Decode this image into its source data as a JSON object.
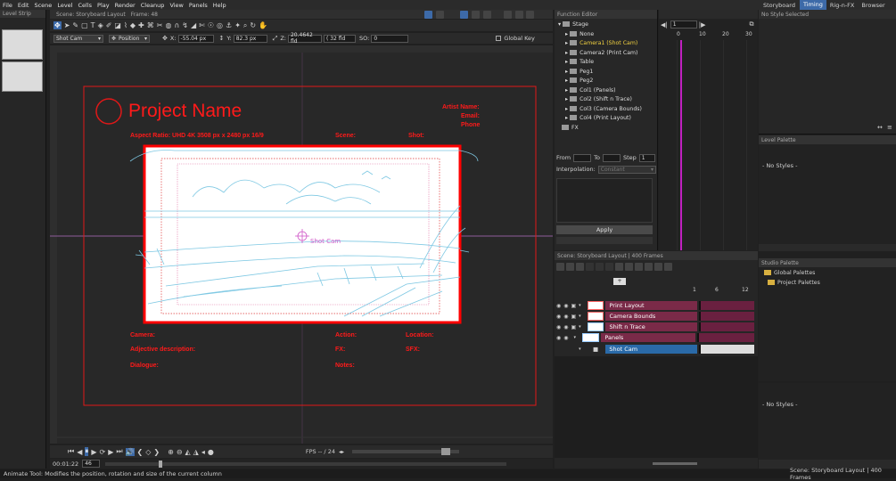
{
  "menu": [
    "File",
    "Edit",
    "Scene",
    "Level",
    "Cells",
    "Play",
    "Render",
    "Cleanup",
    "View",
    "Panels",
    "Help"
  ],
  "level_strip": {
    "title": "Level Strip"
  },
  "viewer": {
    "title": "Scene: Storyboard Layout",
    "frame": "Frame: 48"
  },
  "tool_options": {
    "object": "Shot Cam",
    "mode": "Position",
    "x_label": "X:",
    "x_value": "-55.04 px",
    "y_label": "Y:",
    "y_value": "82.3 px",
    "z_label": "Z:",
    "z_value": "20.4642 fld",
    "z_fld": "( 32 fld",
    "so_label": "SO:",
    "so_value": "0",
    "global_key": "Global Key"
  },
  "storyboard": {
    "project_name": "Project Name",
    "artist_name": "Artist Name:",
    "email": "Email:",
    "phone": "Phone",
    "aspect": "Aspect Ratio: UHD 4K 3508 px  x  2480 px   16/9",
    "scene": "Scene:",
    "shot": "Shot:",
    "camera": "Camera:",
    "action": "Action:",
    "location": "Location:",
    "adjective": "Adjective description:",
    "fx": "FX:",
    "sfx": "SFX:",
    "dialogue": "Dialogue:",
    "notes": "Notes:",
    "cam_label": "Shot   Cam"
  },
  "playback": {
    "fps": "FPS -- / 24",
    "time": "00:01:22",
    "frame": "46"
  },
  "status": "Animate Tool: Modifies the position, rotation and size of the current column",
  "function_editor": {
    "title": "Function Editor",
    "tree": [
      "Stage",
      "None",
      "Camera1 (Shot Cam)",
      "Camera2 (Print Cam)",
      "Table",
      "Peg1",
      "Peg2",
      "Col1 (Panels)",
      "Col2 (Shift n Trace)",
      "Col3 (Camera Bounds)",
      "Col4 (Print Layout)",
      "FX"
    ],
    "from": "From",
    "to": "To",
    "step": "Step",
    "step_value": "1",
    "interpolation": "Interpolation:",
    "interp_value": "Constant",
    "apply": "Apply"
  },
  "curve": {
    "frame": "1",
    "ticks": [
      "0",
      "10",
      "20",
      "30"
    ]
  },
  "xsheet": {
    "title": "Scene: Storyboard Layout  |  400 Frames",
    "frame_ticks": [
      "1",
      "6",
      "12"
    ],
    "layers": [
      {
        "name": "Print Layout",
        "color": "#7a2a48"
      },
      {
        "name": "Camera Bounds",
        "color": "#7a2a48"
      },
      {
        "name": "Shift n Trace",
        "color": "#7a2a48"
      },
      {
        "name": "Panels",
        "color": "#7a2a48"
      },
      {
        "name": "Shot Cam",
        "color": "#2a6aa8"
      }
    ]
  },
  "right_tabs": [
    "Storyboard",
    "Timing",
    "Rig-n-FX",
    "Browser"
  ],
  "style_panel": {
    "selected": "No Style Selected"
  },
  "level_palette": {
    "title": "Level Palette",
    "empty": "- No Styles -"
  },
  "studio_palette": {
    "title": "Studio Palette",
    "items": [
      "Global Palettes",
      "Project Palettes"
    ]
  },
  "bottom_palette": {
    "empty": "- No Styles -"
  },
  "bottom_status": "Scene: Storyboard Layout  |  400 Frames"
}
